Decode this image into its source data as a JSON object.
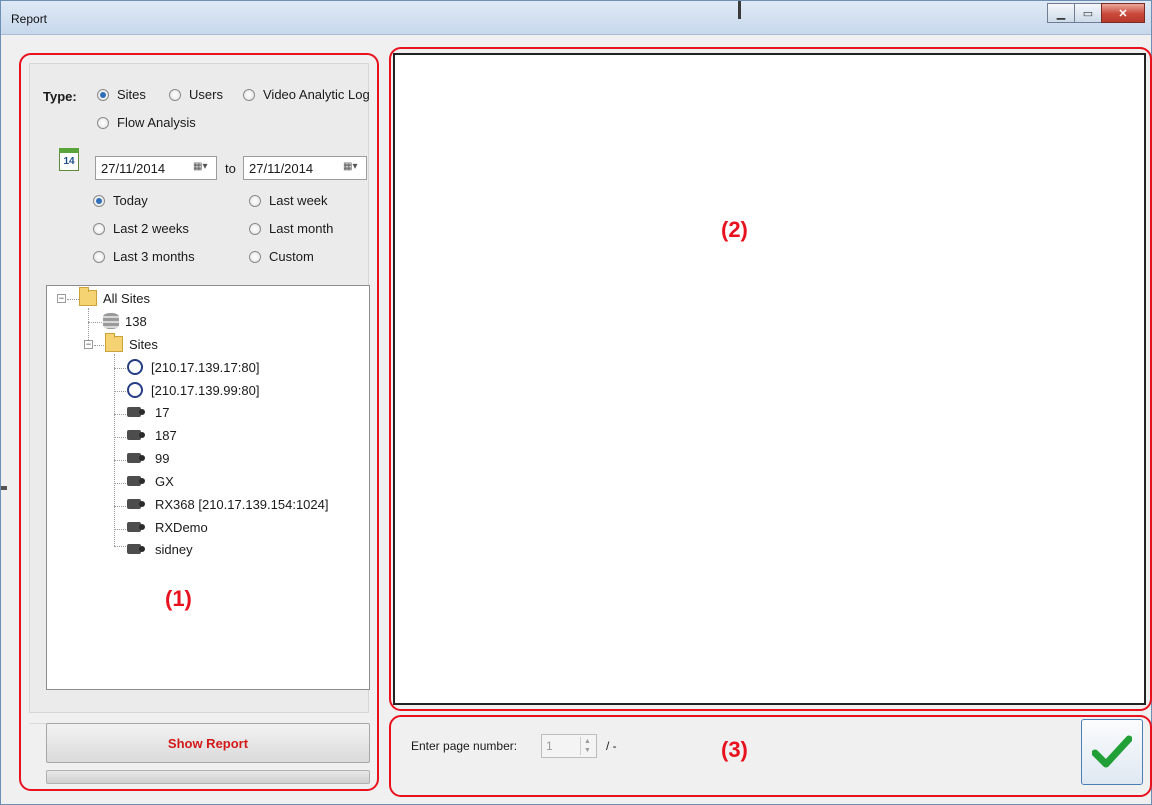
{
  "window": {
    "title": "Report",
    "controls": [
      "minimize",
      "maximize",
      "close"
    ]
  },
  "type_selector": {
    "label": "Type:",
    "options": [
      {
        "label": "Sites",
        "selected": true
      },
      {
        "label": "Users",
        "selected": false
      },
      {
        "label": "Video Analytic Log",
        "selected": false
      },
      {
        "label": "Flow Analysis",
        "selected": false
      }
    ]
  },
  "date_range": {
    "calendar_icon_text": "14",
    "from": "27/11/2014",
    "to_label": "to",
    "to": "27/11/2014",
    "presets": [
      {
        "label": "Today",
        "selected": true
      },
      {
        "label": "Last week",
        "selected": false
      },
      {
        "label": "Last 2 weeks",
        "selected": false
      },
      {
        "label": "Last month",
        "selected": false
      },
      {
        "label": "Last 3 months",
        "selected": false
      },
      {
        "label": "Custom",
        "selected": false
      }
    ]
  },
  "tree": {
    "root": "All Sites",
    "server": "138",
    "group": "Sites",
    "items": [
      {
        "label": "[210.17.139.17:80]",
        "icon": "status-ring"
      },
      {
        "label": "[210.17.139.99:80]",
        "icon": "status-ring"
      },
      {
        "label": "17",
        "icon": "camera"
      },
      {
        "label": "187",
        "icon": "camera"
      },
      {
        "label": "99",
        "icon": "camera"
      },
      {
        "label": "GX",
        "icon": "camera"
      },
      {
        "label": "RX368 [210.17.139.154:1024]",
        "icon": "camera"
      },
      {
        "label": "RXDemo",
        "icon": "camera"
      },
      {
        "label": "sidney",
        "icon": "camera"
      }
    ]
  },
  "annotations": {
    "left": "(1)",
    "report": "(2)",
    "pager": "(3)"
  },
  "actions": {
    "show_report": "Show Report"
  },
  "pager": {
    "label": "Enter page number:",
    "value": "1",
    "total": "/ -"
  },
  "colors": {
    "annotation_red": "#e8121f",
    "ok_check": "#22a038",
    "button_text": "#d21a1a"
  }
}
